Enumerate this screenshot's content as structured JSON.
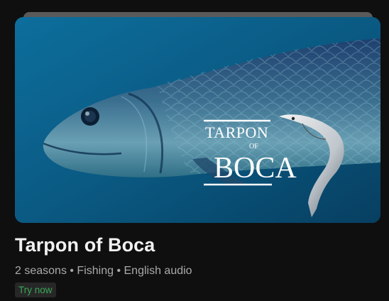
{
  "show": {
    "logo_text_top": "Tarpon",
    "logo_text_mid": "of",
    "logo_text_bottom": "Boca",
    "title": "Tarpon of Boca",
    "meta": "2 seasons • Fishing • English audio",
    "badge": "Try now"
  },
  "colors": {
    "background": "#0f0f0f",
    "title": "#f1f1f1",
    "meta": "#aaaaaa",
    "badge_text": "#3aa757",
    "badge_bg": "#272727"
  }
}
